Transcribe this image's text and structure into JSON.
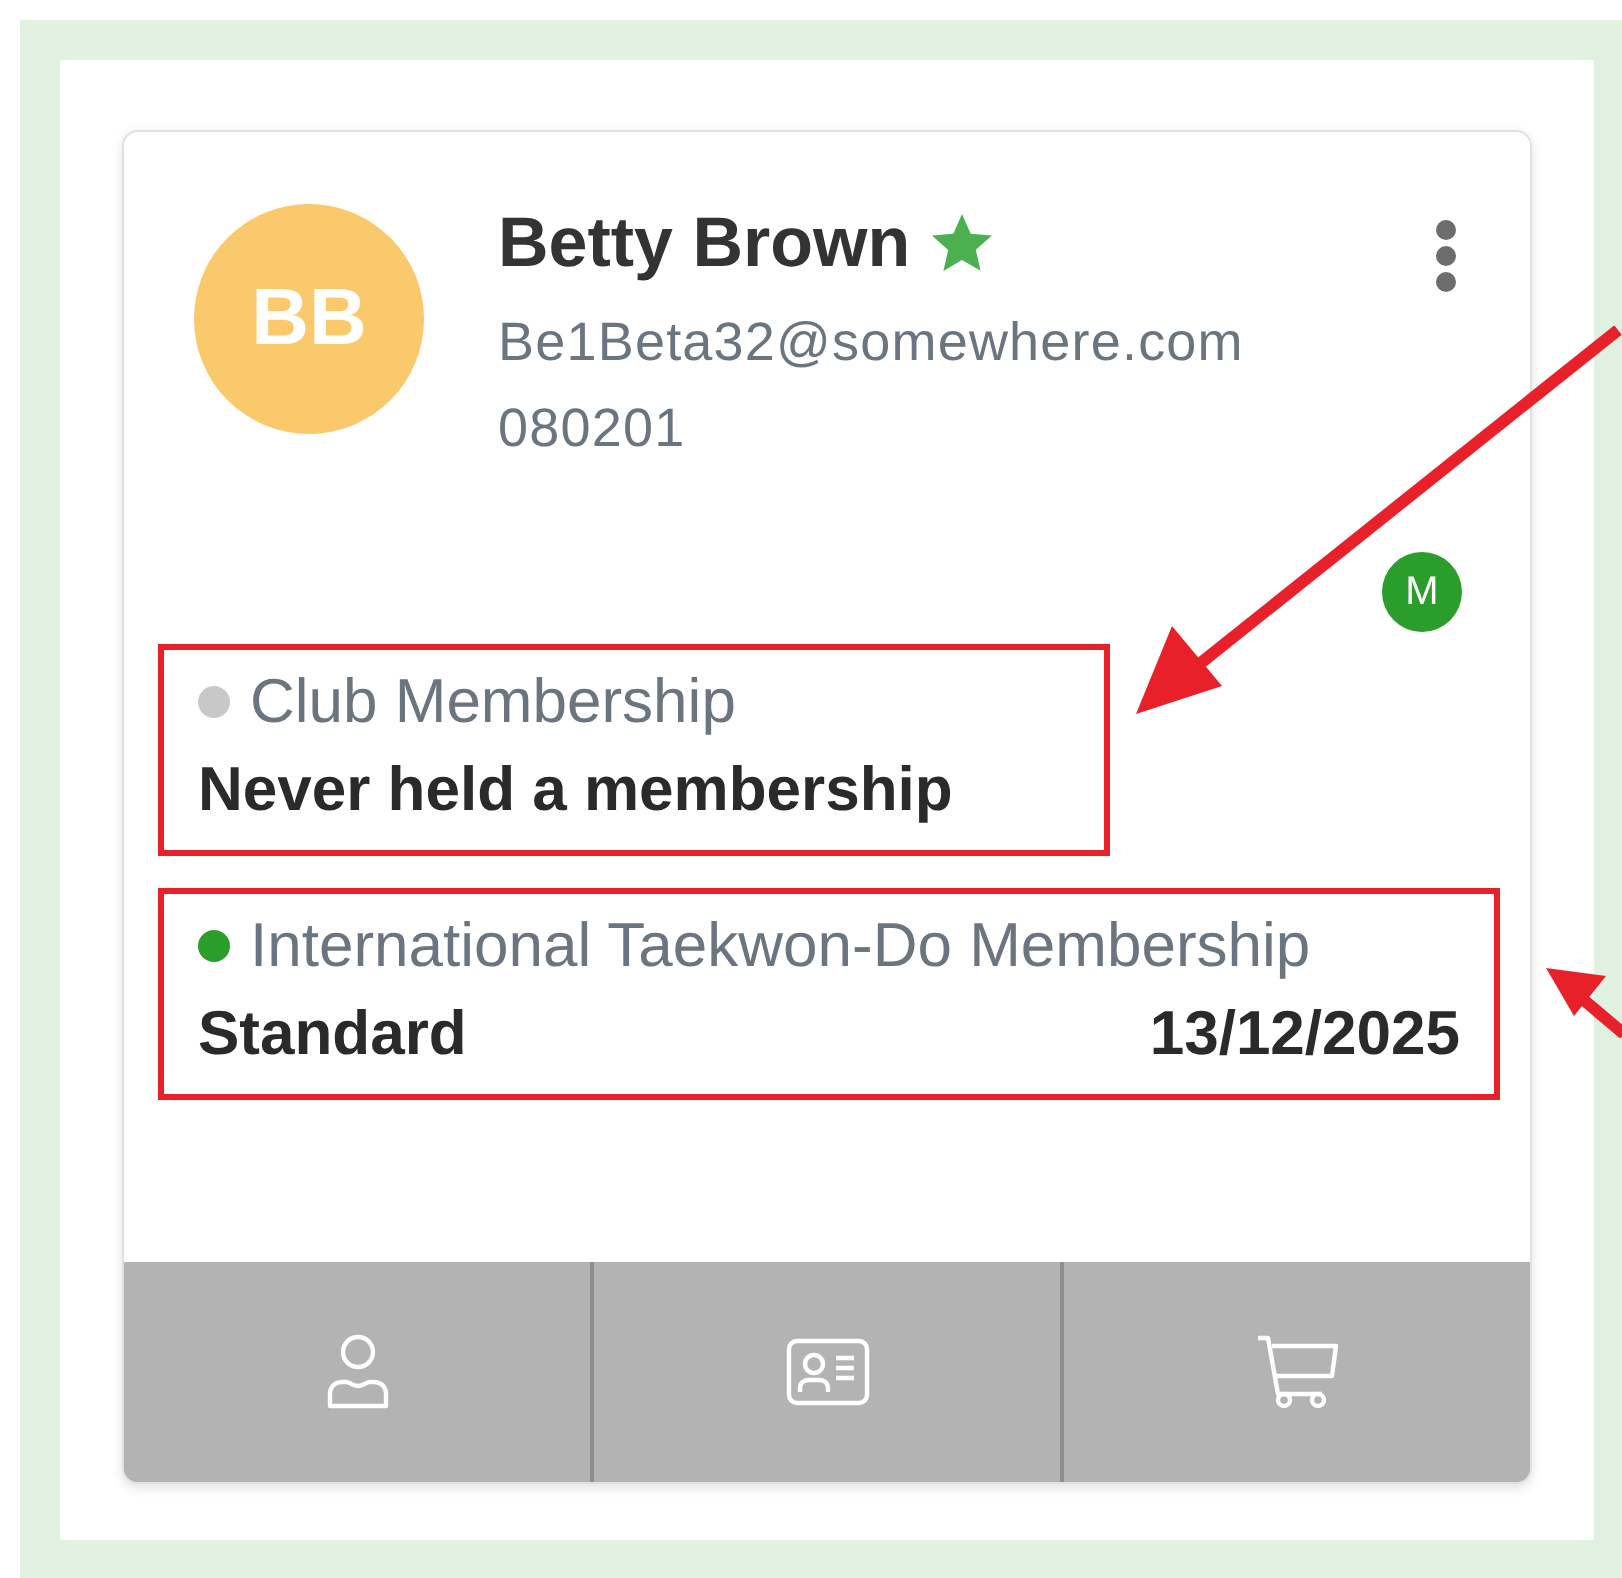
{
  "member": {
    "initials": "BB",
    "name": "Betty Brown",
    "starred": true,
    "email": "Be1Beta32@somewhere.com",
    "number": "080201",
    "badge": "M"
  },
  "memberships": [
    {
      "title": "Club Membership",
      "color": "#c8c8c8",
      "value": "Never held a membership",
      "highlighted": true
    },
    {
      "title": "International Taekwon-Do Membership",
      "color": "#2a9d2a",
      "value": "Standard",
      "expiry": "13/12/2025",
      "highlighted": true
    }
  ],
  "footer_buttons": [
    {
      "kind": "profile"
    },
    {
      "kind": "card"
    },
    {
      "kind": "cart"
    }
  ]
}
